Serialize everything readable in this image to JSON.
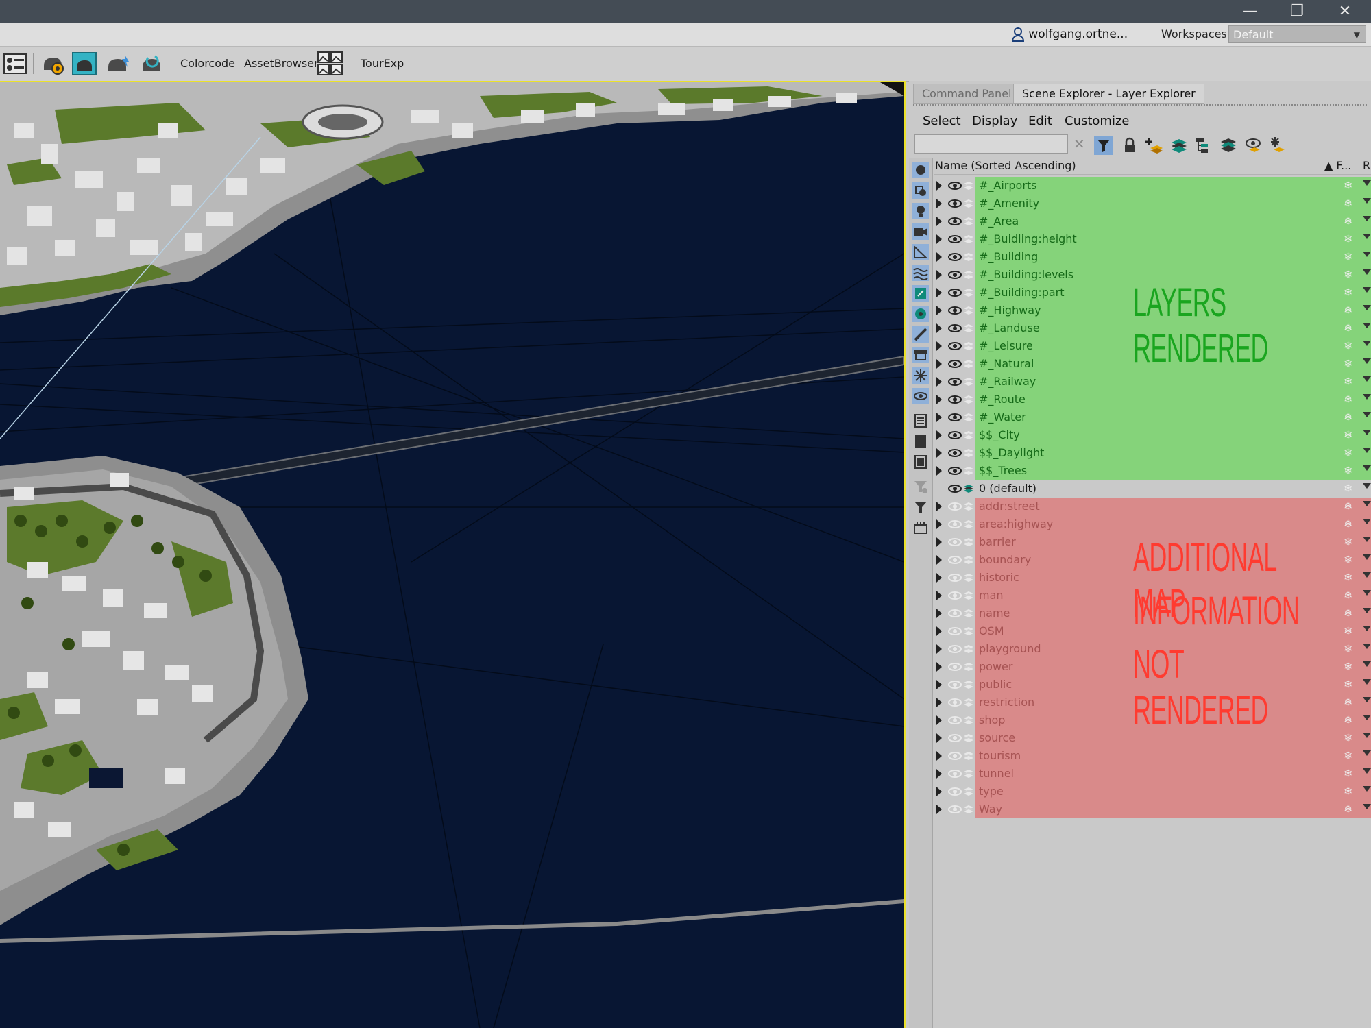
{
  "window": {
    "controls": {
      "minimize": "—",
      "restore": "❐",
      "close": "✕"
    }
  },
  "userbar": {
    "user_name": "wolfgang.ortne...",
    "workspaces_label": "Workspaces:",
    "workspace_value": "Default"
  },
  "toolbar": {
    "items": [
      "Colorcode",
      "AssetBrowser",
      "TourExp"
    ]
  },
  "panel": {
    "tabs": [
      "Command Panel",
      "Scene Explorer - Layer Explorer"
    ],
    "menu": [
      "Select",
      "Display",
      "Edit",
      "Customize"
    ],
    "column_header": "Name (Sorted Ascending)",
    "column_f": "▲ F...",
    "column_r": "R",
    "rendered_layers": [
      "#_Airports",
      "#_Amenity",
      "#_Area",
      "#_Buidling:height",
      "#_Building",
      "#_Building:levels",
      "#_Building:part",
      "#_Highway",
      "#_Landuse",
      "#_Leisure",
      "#_Natural",
      "#_Railway",
      "#_Route",
      "#_Water",
      "$$_City",
      "$$_Daylight",
      "$$_Trees"
    ],
    "default_layer": "0 (default)",
    "unrendered_layers": [
      "addr:street",
      "area:highway",
      "barrier",
      "boundary",
      "historic",
      "man",
      "name",
      "OSM",
      "playground",
      "power",
      "public",
      "restriction",
      "shop",
      "source",
      "tourism",
      "tunnel",
      "type",
      "Way"
    ],
    "annotation_rendered": "LAYERS RENDERED",
    "annotation_not_rendered": [
      "ADDITIONAL MAP",
      "INFORMATION",
      "NOT RENDERED"
    ]
  },
  "colors": {
    "rendered_bg": "#85d37a",
    "rendered_text": "#156a18",
    "not_rendered_bg": "#d98a8a",
    "not_rendered_text": "#a65252",
    "annotation_green": "#1aa51f",
    "annotation_red": "#ff3b30",
    "viewport_bg": "#081633"
  }
}
